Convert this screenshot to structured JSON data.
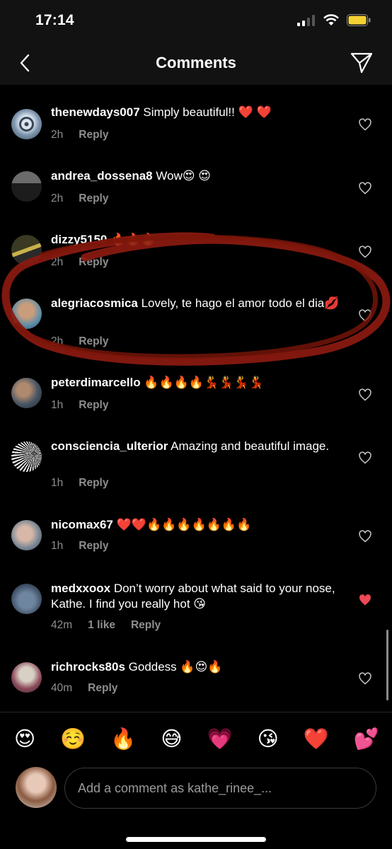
{
  "status_bar": {
    "time": "17:14"
  },
  "header": {
    "title": "Comments"
  },
  "comments": [
    {
      "username": "thenewdays007",
      "text": "Simply beautiful!! ❤️ ❤️",
      "time": "2h",
      "likes": "",
      "reply": "Reply",
      "liked": false
    },
    {
      "username": "andrea_dossena8",
      "text": "Wow😍 😍",
      "time": "2h",
      "likes": "",
      "reply": "Reply",
      "liked": false
    },
    {
      "username": "dizzy5150",
      "text": "🔥🔥🔥",
      "time": "2h",
      "likes": "",
      "reply": "Reply",
      "liked": false
    },
    {
      "username": "alegriacosmica",
      "text": "Lovely, te hago el amor todo el dia💋",
      "time": "2h",
      "likes": "",
      "reply": "Reply",
      "liked": false
    },
    {
      "username": "peterdimarcello",
      "text": "🔥🔥🔥🔥💃💃💃💃",
      "time": "1h",
      "likes": "",
      "reply": "Reply",
      "liked": false
    },
    {
      "username": "consciencia_ulterior",
      "text": "Amazing and beautiful image.",
      "time": "1h",
      "likes": "",
      "reply": "Reply",
      "liked": false
    },
    {
      "username": "nicomax67",
      "text": "❤️❤️🔥🔥🔥🔥🔥🔥🔥",
      "time": "1h",
      "likes": "",
      "reply": "Reply",
      "liked": false
    },
    {
      "username": "medxxoox",
      "text": "Don’t worry about what said to your nose, Kathe. I find you really hot 😘",
      "time": "42m",
      "likes": "1 like",
      "reply": "Reply",
      "liked": true
    },
    {
      "username": "richrocks80s",
      "text": "Goddess 🔥😍🔥",
      "time": "40m",
      "likes": "",
      "reply": "Reply",
      "liked": false
    }
  ],
  "emoji_bar": [
    "😍",
    "☺️",
    "🔥",
    "😅",
    "💗",
    "😘",
    "❤️",
    "💕"
  ],
  "input": {
    "placeholder": "Add a comment as kathe_rinee_..."
  },
  "colors": {
    "background": "#000000",
    "header": "#121212",
    "meta": "#8e8e8e",
    "liked_heart": "#ed4956",
    "scribble": "#8b1a10"
  }
}
